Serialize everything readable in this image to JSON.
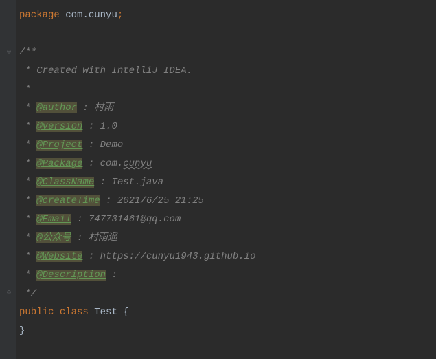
{
  "code": {
    "package_kw": "package",
    "package_name_p1": "com",
    "package_dot": ".",
    "package_name_p2": "cunyu",
    "semicolon": ";",
    "javadoc_open": "/**",
    "javadoc_star": " *",
    "javadoc_line1": " * Created with IntelliJ IDEA.",
    "javadoc_close": " */",
    "tags": {
      "author": "@author",
      "author_val": " : 村雨",
      "version": "@version",
      "version_val": " : 1.0",
      "project": "@Project",
      "project_val": " : Demo",
      "package": "@Package",
      "package_val_pre": " : com.",
      "package_val_wavy": "cunyu",
      "classname": "@ClassName",
      "classname_val": " : Test.java",
      "createtime": "@createTime",
      "createtime_val": " : 2021/6/25 21:25",
      "email": "@Email",
      "email_val": " : 747731461@qq.com",
      "gzh": "@公众号",
      "gzh_val": " : 村雨遥",
      "website": "@Website",
      "website_val": " : https://cunyu1943.github.io",
      "description": "@Description",
      "description_val": " :"
    },
    "public_kw": "public",
    "class_kw": "class",
    "class_name": "Test",
    "open_brace": "{",
    "close_brace": "}",
    "tag_prefix": " * "
  }
}
